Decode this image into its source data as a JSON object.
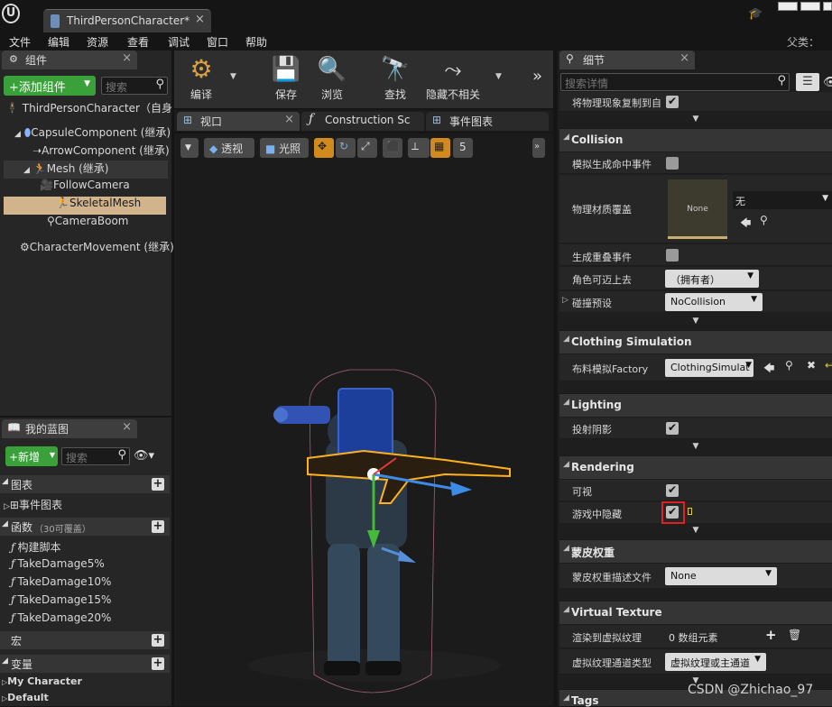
{
  "window": {
    "tab_title": "ThirdPersonCharacter*",
    "user_label": "父类：  角"
  },
  "menu": [
    "文件",
    "编辑",
    "资源",
    "查看",
    "调试",
    "窗口",
    "帮助"
  ],
  "components_panel": {
    "tab": "组件",
    "add_button": "+添加组件",
    "search_placeholder": "搜索",
    "items": [
      {
        "label": "ThirdPersonCharacter（自身",
        "depth": 0
      },
      {
        "label": "CapsuleComponent (继承)",
        "depth": 1
      },
      {
        "label": "ArrowComponent (继承)",
        "depth": 2
      },
      {
        "label": "Mesh (继承)",
        "depth": 2
      },
      {
        "label": "FollowCamera",
        "depth": 3
      },
      {
        "label": "SkeletalMesh",
        "depth": 3
      },
      {
        "label": "CameraBoom",
        "depth": 3
      },
      {
        "label": "CharacterMovement (继承)",
        "depth": 1
      }
    ]
  },
  "toolbar": {
    "compile": "编译",
    "save": "保存",
    "browse": "浏览",
    "find": "查找",
    "hide_unrelated": "隐藏不相关"
  },
  "editor_tabs": [
    "视口",
    "Construction Sc",
    "事件图表"
  ],
  "viewport": {
    "perspective": "透视",
    "lit": "光照",
    "grid_size": "5"
  },
  "blueprint_panel": {
    "tab": "我的蓝图",
    "new_button": "+新增",
    "search_placeholder": "搜索",
    "graphs_header": "图表",
    "event_graph": "事件图表",
    "functions_header": "函数",
    "functions_note": "（30可覆盖）",
    "functions": [
      "构建脚本",
      "TakeDamage5%",
      "TakeDamage10%",
      "TakeDamage15%",
      "TakeDamage20%"
    ],
    "macros_header": "宏",
    "variables_header": "变量",
    "variable_groups": [
      "My Character",
      "Default"
    ]
  },
  "details_panel": {
    "tab": "细节",
    "search_placeholder": "搜索详情",
    "replicate_label": "将物理现象复制到自",
    "sections": {
      "collision": "Collision",
      "clothing": "Clothing Simulation",
      "lighting": "Lighting",
      "rendering": "Rendering",
      "skin_weight": "蒙皮权重",
      "virtual_texture": "Virtual Texture",
      "tags": "Tags"
    },
    "collision": {
      "sim_hit_label": "模拟生成命中事件",
      "phys_mat_label": "物理材质覆盖",
      "phys_mat_thumb": "None",
      "phys_mat_value": "无",
      "overlap_label": "生成重叠事件",
      "step_up_label": "角色可迈上去",
      "step_up_value": "（拥有者）",
      "preset_label": "碰撞预设",
      "preset_value": "NoCollision"
    },
    "clothing": {
      "factory_label": "布料模拟Factory",
      "factory_value": "ClothingSimulat"
    },
    "lighting": {
      "cast_shadow_label": "投射阴影"
    },
    "rendering": {
      "visible_label": "可视",
      "hidden_in_game_label": "游戏中隐藏"
    },
    "skin_weight": {
      "profile_label": "蒙皮权重描述文件",
      "profile_value": "None"
    },
    "virtual_texture": {
      "render_label": "渲染到虚拟纹理",
      "render_value": "0 数组元素",
      "pass_type_label": "虚拟纹理通道类型",
      "pass_type_value": "虚拟纹理或主通道"
    }
  },
  "watermark": "CSDN @Zhichao_97",
  "colors": {
    "selection": "#d2b48c",
    "highlight_box": "#e02020",
    "add_button": "#3aa13a"
  }
}
